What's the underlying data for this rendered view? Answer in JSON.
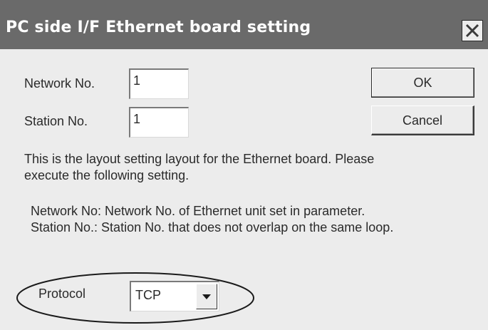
{
  "window": {
    "title": "PC side I/F  Ethernet board setting"
  },
  "form": {
    "network_no_label": "Network No.",
    "network_no_value": "1",
    "station_no_label": "Station No.",
    "station_no_value": "1"
  },
  "buttons": {
    "ok_label": "OK",
    "cancel_label": "Cancel"
  },
  "description": {
    "line1": "This is the layout setting layout for the Ethernet board. Please",
    "line2": "execute the following setting."
  },
  "notes": {
    "line1": "Network No: Network No. of Ethernet unit set in parameter.",
    "line2": "Station No.: Station No. that does not overlap on the same loop."
  },
  "protocol": {
    "label": "Protocol",
    "selected": "TCP"
  },
  "colors": {
    "titlebar": "#6a6a6a",
    "window_bg": "#ececec",
    "highlight_ellipse": "#1a1a1a"
  },
  "icons": {
    "close": "close-x-icon",
    "dropdown": "chevron-down-icon"
  }
}
